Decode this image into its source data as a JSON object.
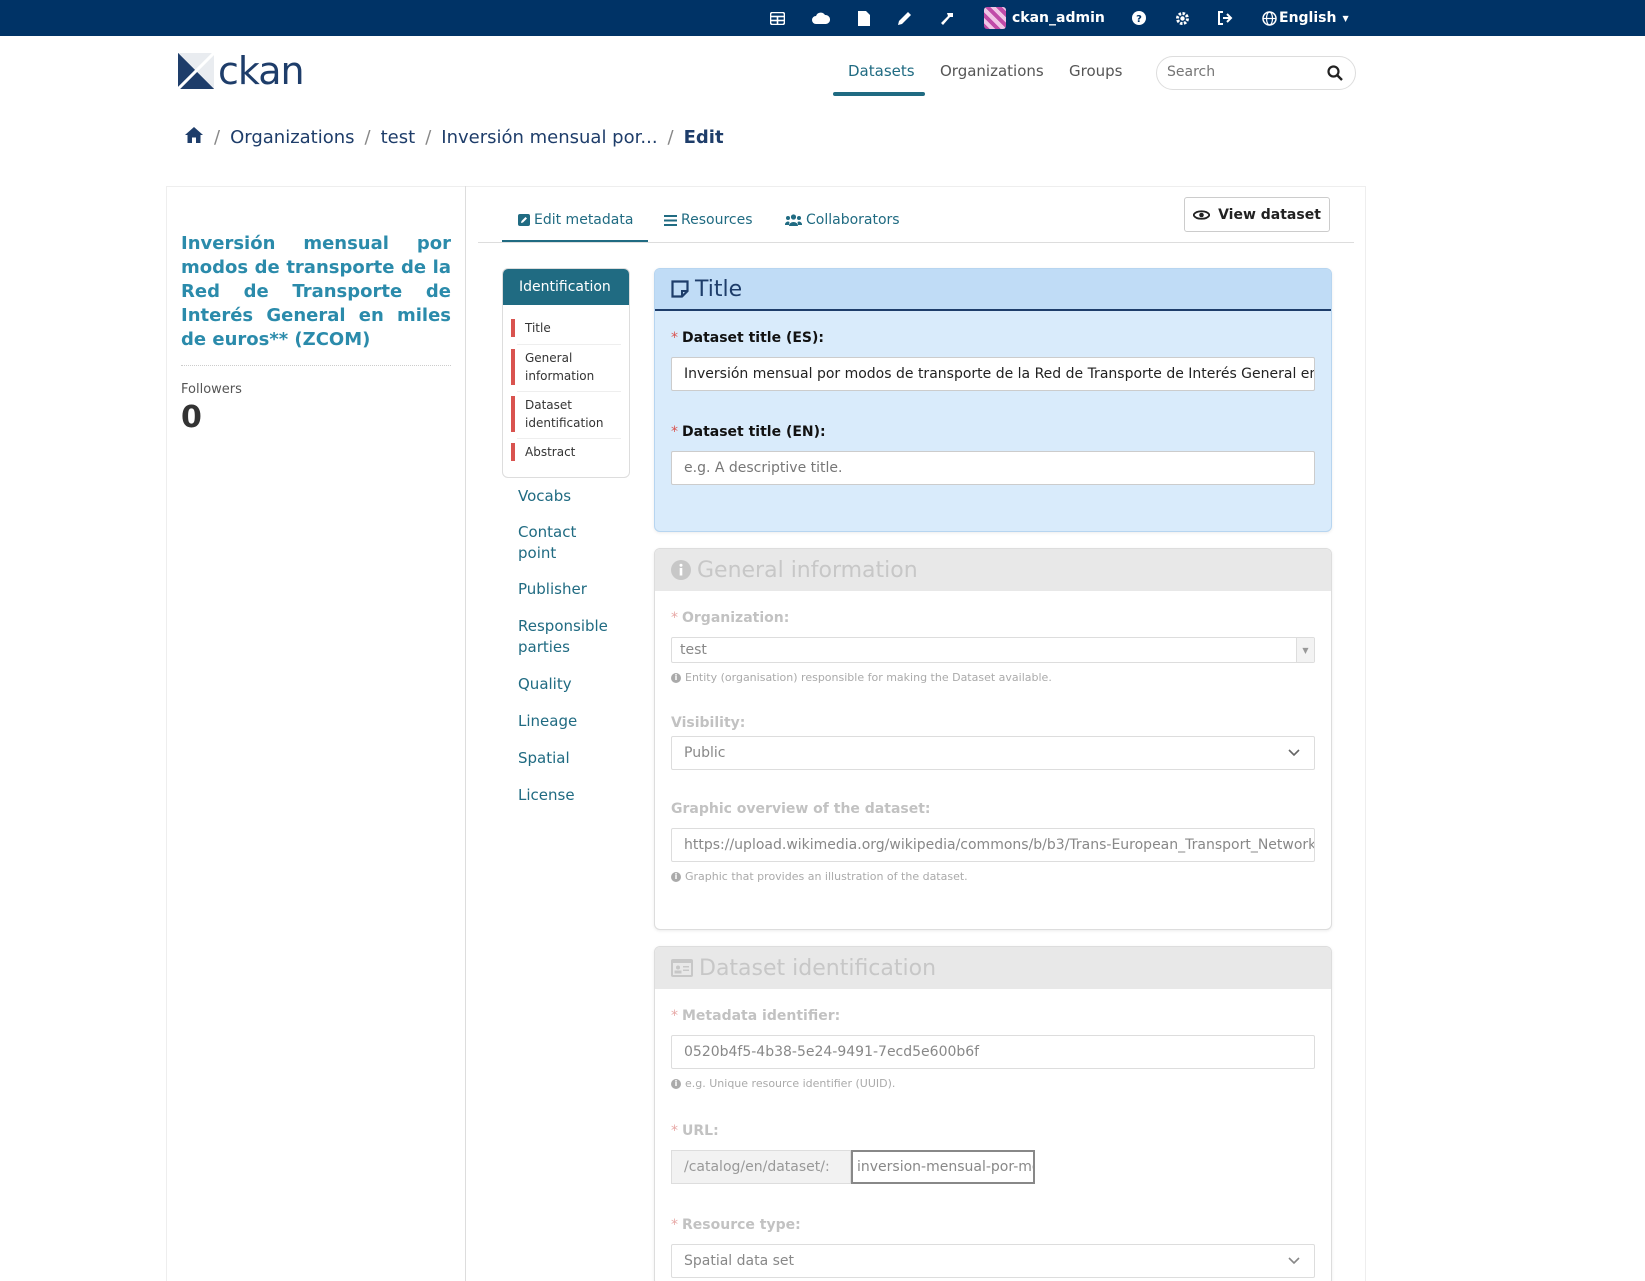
{
  "account": {
    "username": "ckan_admin",
    "language": "English",
    "icons": [
      "dashboard-icon",
      "cloud-icon",
      "file-icon",
      "pencil-icon",
      "hammer-icon",
      "help-icon",
      "gear-icon",
      "sign-out-icon",
      "globe-icon"
    ]
  },
  "header": {
    "logo_text": "ckan",
    "nav": [
      "Datasets",
      "Organizations",
      "Groups"
    ],
    "search_placeholder": "Search"
  },
  "breadcrumb": {
    "items": [
      "Organizations",
      "test",
      "Inversión mensual por..."
    ],
    "active": "Edit"
  },
  "sidebar": {
    "dataset_title": "Inversión mensual por modos de transporte de la Red de Transporte de Interés General en miles de euros** (ZCOM)",
    "followers_label": "Followers",
    "followers_count": "0"
  },
  "tabs": {
    "edit_metadata": "Edit metadata",
    "resources": "Resources",
    "collaborators": "Collaborators",
    "view_dataset": "View dataset"
  },
  "form_nav": {
    "identification": "Identification",
    "sub_items": [
      "Title",
      "General information",
      "Dataset identification",
      "Abstract"
    ],
    "links": [
      "Vocabs",
      "Contact point",
      "Publisher",
      "Responsible parties",
      "Quality",
      "Lineage",
      "Spatial",
      "License"
    ]
  },
  "panels": {
    "title": {
      "heading": "Title",
      "title_es_label": "Dataset title (ES):",
      "title_es_value": "Inversión mensual por modos de transporte de la Red de Transporte de Interés General en miles de euros** (ZCOM)",
      "title_en_label": "Dataset title (EN):",
      "title_en_placeholder": "e.g. A descriptive title."
    },
    "general": {
      "heading": "General information",
      "organization_label": "Organization:",
      "organization_value": "test",
      "organization_help": "Entity (organisation) responsible for making the Dataset available.",
      "visibility_label": "Visibility:",
      "visibility_value": "Public",
      "graphic_label": "Graphic overview of the dataset:",
      "graphic_value": "https://upload.wikimedia.org/wikipedia/commons/b/b3/Trans-European_Transport_Network.png",
      "graphic_help": "Graphic that provides an illustration of the dataset."
    },
    "identification": {
      "heading": "Dataset identification",
      "metadata_id_label": "Metadata identifier:",
      "metadata_id_value": "0520b4f5-4b38-5e24-9491-7ecd5e600b6f",
      "metadata_id_help": "e.g. Unique resource identifier (UUID).",
      "url_label": "URL:",
      "url_prefix": "/catalog/en/dataset/:",
      "url_value": "inversion-mensual-por-modos",
      "resource_type_label": "Resource type:",
      "resource_type_value": "Spatial data set"
    }
  },
  "colors": {
    "masthead": "#003366",
    "accent": "#206b82",
    "title_link": "#2b8bab",
    "required": "#d9534f",
    "title_panel": "#d9ebfb"
  }
}
